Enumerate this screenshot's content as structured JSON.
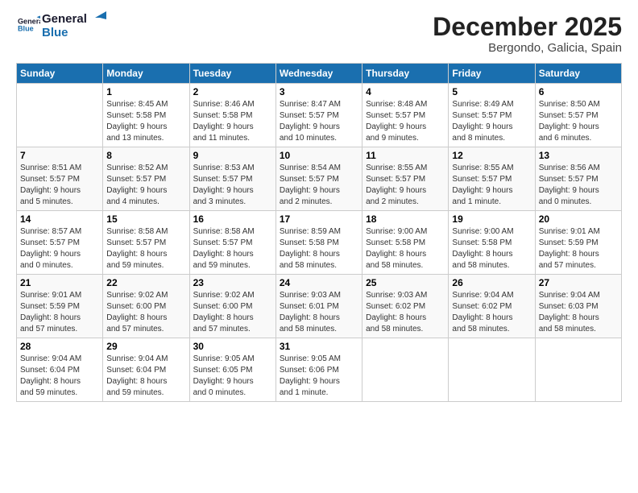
{
  "logo": {
    "line1": "General",
    "line2": "Blue"
  },
  "title": {
    "month": "December 2025",
    "location": "Bergondo, Galicia, Spain"
  },
  "headers": [
    "Sunday",
    "Monday",
    "Tuesday",
    "Wednesday",
    "Thursday",
    "Friday",
    "Saturday"
  ],
  "weeks": [
    [
      {
        "day": "",
        "info": ""
      },
      {
        "day": "1",
        "info": "Sunrise: 8:45 AM\nSunset: 5:58 PM\nDaylight: 9 hours\nand 13 minutes."
      },
      {
        "day": "2",
        "info": "Sunrise: 8:46 AM\nSunset: 5:58 PM\nDaylight: 9 hours\nand 11 minutes."
      },
      {
        "day": "3",
        "info": "Sunrise: 8:47 AM\nSunset: 5:57 PM\nDaylight: 9 hours\nand 10 minutes."
      },
      {
        "day": "4",
        "info": "Sunrise: 8:48 AM\nSunset: 5:57 PM\nDaylight: 9 hours\nand 9 minutes."
      },
      {
        "day": "5",
        "info": "Sunrise: 8:49 AM\nSunset: 5:57 PM\nDaylight: 9 hours\nand 8 minutes."
      },
      {
        "day": "6",
        "info": "Sunrise: 8:50 AM\nSunset: 5:57 PM\nDaylight: 9 hours\nand 6 minutes."
      }
    ],
    [
      {
        "day": "7",
        "info": "Sunrise: 8:51 AM\nSunset: 5:57 PM\nDaylight: 9 hours\nand 5 minutes."
      },
      {
        "day": "8",
        "info": "Sunrise: 8:52 AM\nSunset: 5:57 PM\nDaylight: 9 hours\nand 4 minutes."
      },
      {
        "day": "9",
        "info": "Sunrise: 8:53 AM\nSunset: 5:57 PM\nDaylight: 9 hours\nand 3 minutes."
      },
      {
        "day": "10",
        "info": "Sunrise: 8:54 AM\nSunset: 5:57 PM\nDaylight: 9 hours\nand 2 minutes."
      },
      {
        "day": "11",
        "info": "Sunrise: 8:55 AM\nSunset: 5:57 PM\nDaylight: 9 hours\nand 2 minutes."
      },
      {
        "day": "12",
        "info": "Sunrise: 8:55 AM\nSunset: 5:57 PM\nDaylight: 9 hours\nand 1 minute."
      },
      {
        "day": "13",
        "info": "Sunrise: 8:56 AM\nSunset: 5:57 PM\nDaylight: 9 hours\nand 0 minutes."
      }
    ],
    [
      {
        "day": "14",
        "info": "Sunrise: 8:57 AM\nSunset: 5:57 PM\nDaylight: 9 hours\nand 0 minutes."
      },
      {
        "day": "15",
        "info": "Sunrise: 8:58 AM\nSunset: 5:57 PM\nDaylight: 8 hours\nand 59 minutes."
      },
      {
        "day": "16",
        "info": "Sunrise: 8:58 AM\nSunset: 5:57 PM\nDaylight: 8 hours\nand 59 minutes."
      },
      {
        "day": "17",
        "info": "Sunrise: 8:59 AM\nSunset: 5:58 PM\nDaylight: 8 hours\nand 58 minutes."
      },
      {
        "day": "18",
        "info": "Sunrise: 9:00 AM\nSunset: 5:58 PM\nDaylight: 8 hours\nand 58 minutes."
      },
      {
        "day": "19",
        "info": "Sunrise: 9:00 AM\nSunset: 5:58 PM\nDaylight: 8 hours\nand 58 minutes."
      },
      {
        "day": "20",
        "info": "Sunrise: 9:01 AM\nSunset: 5:59 PM\nDaylight: 8 hours\nand 57 minutes."
      }
    ],
    [
      {
        "day": "21",
        "info": "Sunrise: 9:01 AM\nSunset: 5:59 PM\nDaylight: 8 hours\nand 57 minutes."
      },
      {
        "day": "22",
        "info": "Sunrise: 9:02 AM\nSunset: 6:00 PM\nDaylight: 8 hours\nand 57 minutes."
      },
      {
        "day": "23",
        "info": "Sunrise: 9:02 AM\nSunset: 6:00 PM\nDaylight: 8 hours\nand 57 minutes."
      },
      {
        "day": "24",
        "info": "Sunrise: 9:03 AM\nSunset: 6:01 PM\nDaylight: 8 hours\nand 58 minutes."
      },
      {
        "day": "25",
        "info": "Sunrise: 9:03 AM\nSunset: 6:02 PM\nDaylight: 8 hours\nand 58 minutes."
      },
      {
        "day": "26",
        "info": "Sunrise: 9:04 AM\nSunset: 6:02 PM\nDaylight: 8 hours\nand 58 minutes."
      },
      {
        "day": "27",
        "info": "Sunrise: 9:04 AM\nSunset: 6:03 PM\nDaylight: 8 hours\nand 58 minutes."
      }
    ],
    [
      {
        "day": "28",
        "info": "Sunrise: 9:04 AM\nSunset: 6:04 PM\nDaylight: 8 hours\nand 59 minutes."
      },
      {
        "day": "29",
        "info": "Sunrise: 9:04 AM\nSunset: 6:04 PM\nDaylight: 8 hours\nand 59 minutes."
      },
      {
        "day": "30",
        "info": "Sunrise: 9:05 AM\nSunset: 6:05 PM\nDaylight: 9 hours\nand 0 minutes."
      },
      {
        "day": "31",
        "info": "Sunrise: 9:05 AM\nSunset: 6:06 PM\nDaylight: 9 hours\nand 1 minute."
      },
      {
        "day": "",
        "info": ""
      },
      {
        "day": "",
        "info": ""
      },
      {
        "day": "",
        "info": ""
      }
    ]
  ]
}
